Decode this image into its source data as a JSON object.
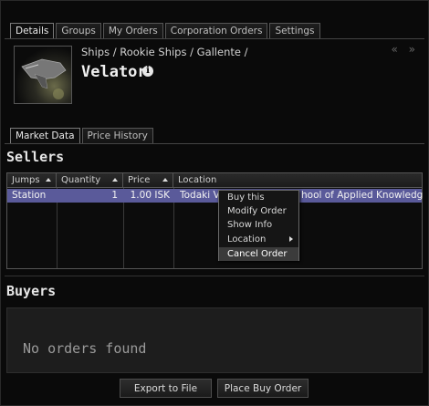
{
  "top_tabs": [
    "Details",
    "Groups",
    "My Orders",
    "Corporation Orders",
    "Settings"
  ],
  "item": {
    "breadcrumb": "Ships / Rookie Ships / Gallente /",
    "name": "Velator",
    "info_icon_label": "i",
    "nav_arrows": "« »"
  },
  "sub_tabs": [
    "Market Data",
    "Price History"
  ],
  "sellers": {
    "title": "Sellers",
    "columns": [
      "Jumps",
      "Quantity",
      "Price",
      "Location"
    ],
    "rows": [
      {
        "jumps": "Station",
        "quantity": "1",
        "price": "1.00 ISK",
        "location_start": "Todaki V",
        "location_end": "hool of Applied Knowledg"
      }
    ]
  },
  "context_menu": {
    "items": [
      "Buy this",
      "Modify Order",
      "Show Info",
      "Location",
      "Cancel Order"
    ],
    "highlighted": "Cancel Order"
  },
  "buyers": {
    "title": "Buyers",
    "empty_message": "No orders found"
  },
  "buttons": {
    "export": "Export to File",
    "place_buy": "Place Buy Order"
  },
  "colors": {
    "selected_row": "#5a5a9a",
    "background": "#0a0a0a"
  }
}
